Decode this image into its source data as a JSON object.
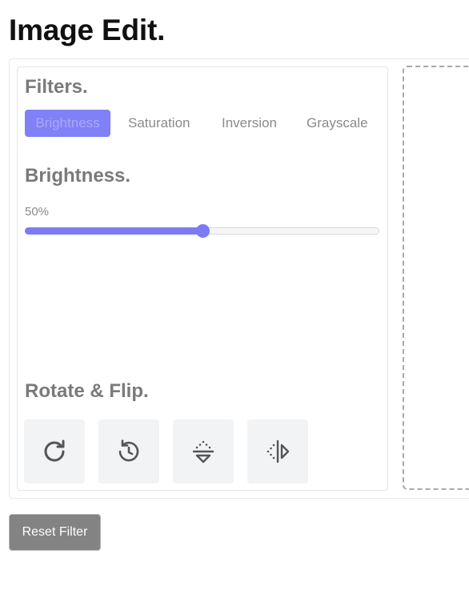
{
  "page": {
    "title": "Image Edit."
  },
  "filters": {
    "title": "Filters.",
    "options": [
      "Brightness",
      "Saturation",
      "Inversion",
      "Grayscale"
    ],
    "active_index": 0
  },
  "slider": {
    "name": "Brightness.",
    "value_label": "50%",
    "value_percent": 50,
    "max_percent": 100
  },
  "rotate_flip": {
    "title": "Rotate & Flip.",
    "buttons": [
      {
        "icon": "rotate-right-icon"
      },
      {
        "icon": "rotate-left-icon"
      },
      {
        "icon": "flip-vertical-icon"
      },
      {
        "icon": "flip-horizontal-icon"
      }
    ]
  },
  "reset": {
    "label": "Reset Filter"
  },
  "colors": {
    "accent": "#7b7bf5",
    "reset_button": "#838383",
    "tool_button_bg": "#f2f3f5",
    "icon_color": "#555555"
  }
}
